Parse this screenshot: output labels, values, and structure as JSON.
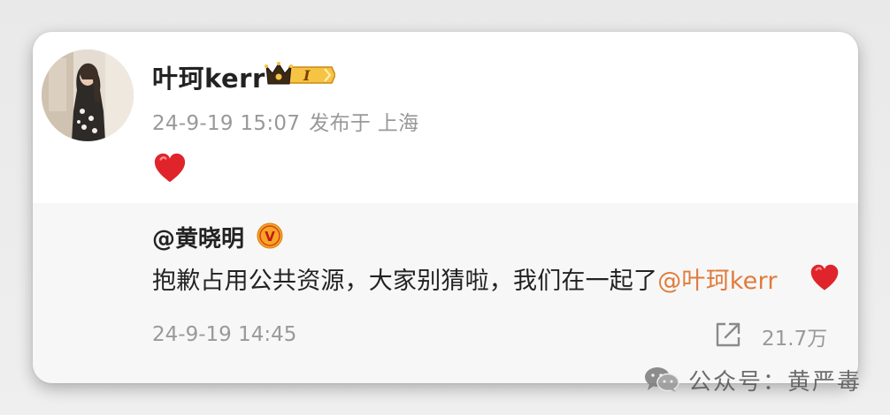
{
  "post": {
    "author": "叶珂kerr",
    "badge_text": "I",
    "timestamp": "24-9-19 15:07",
    "location": "发布于 上海",
    "content_emoji": "red-heart"
  },
  "repost": {
    "author": "@黄晓明",
    "verified_mark": "V",
    "text": "抱歉占用公共资源，大家别猜啦，我们在一起了",
    "mention": "@叶珂kerr",
    "timestamp": "24-9-19 14:45",
    "share_count": "21.7万"
  },
  "watermark": {
    "text": "公众号：黄严毒"
  },
  "colors": {
    "mention": "#e07b3c",
    "heart": "#e0242c",
    "verified": "#f5a623",
    "meta_gray": "#999999"
  },
  "icons": {
    "vip": "crown-level-badge-icon",
    "verified": "verified-v-icon",
    "share": "share-icon",
    "watermark": "wechat-icon"
  }
}
